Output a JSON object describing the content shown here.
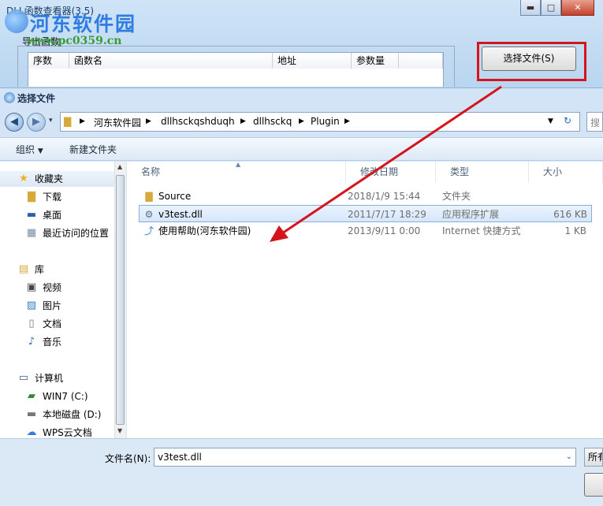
{
  "background_window": {
    "title": "DLL函数查看器(3.5)",
    "export_label": "导出函数",
    "columns": [
      "序数",
      "函数名",
      "地址",
      "参数量"
    ],
    "select_file_button": "选择文件(S)",
    "window_controls": [
      "minimize-icon",
      "maximize-icon",
      "close-icon"
    ]
  },
  "watermark": {
    "brand": "河东软件园",
    "url": "www.pc0359.cn"
  },
  "dialog": {
    "title": "选择文件",
    "breadcrumb": [
      "河东软件园",
      "dllhsckqshduqh",
      "dllhsckq",
      "Plugin"
    ],
    "search_placeholder": "搜",
    "toolbar": {
      "organize": "组织",
      "new_folder": "新建文件夹"
    },
    "nav": {
      "favorites": {
        "label": "收藏夹",
        "items": [
          "下载",
          "桌面",
          "最近访问的位置"
        ]
      },
      "libraries": {
        "label": "库",
        "items": [
          "视频",
          "图片",
          "文档",
          "音乐"
        ]
      },
      "computer": {
        "label": "计算机",
        "items": [
          "WIN7 (C:)",
          "本地磁盘 (D:)",
          "WPS云文档"
        ]
      }
    },
    "columns": {
      "name": "名称",
      "modified": "修改日期",
      "type": "类型",
      "size": "大小"
    },
    "files": [
      {
        "name": "Source",
        "modified": "2018/1/9 15:44",
        "type": "文件夹",
        "size": "",
        "icon": "folder-icon",
        "selected": false
      },
      {
        "name": "v3test.dll",
        "modified": "2011/7/17 18:29",
        "type": "应用程序扩展",
        "size": "616 KB",
        "icon": "dll-file-icon",
        "selected": true
      },
      {
        "name": "使用帮助(河东软件园)",
        "modified": "2013/9/11 0:00",
        "type": "Internet 快捷方式",
        "size": "1 KB",
        "icon": "shortcut-icon",
        "selected": false
      }
    ],
    "filename_label": "文件名(N):",
    "filename_value": "v3test.dll",
    "filter_text": "所有"
  },
  "colors": {
    "highlight_box": "#d4151c",
    "arrow": "#d4151c",
    "selection": "#d6e7fa"
  }
}
